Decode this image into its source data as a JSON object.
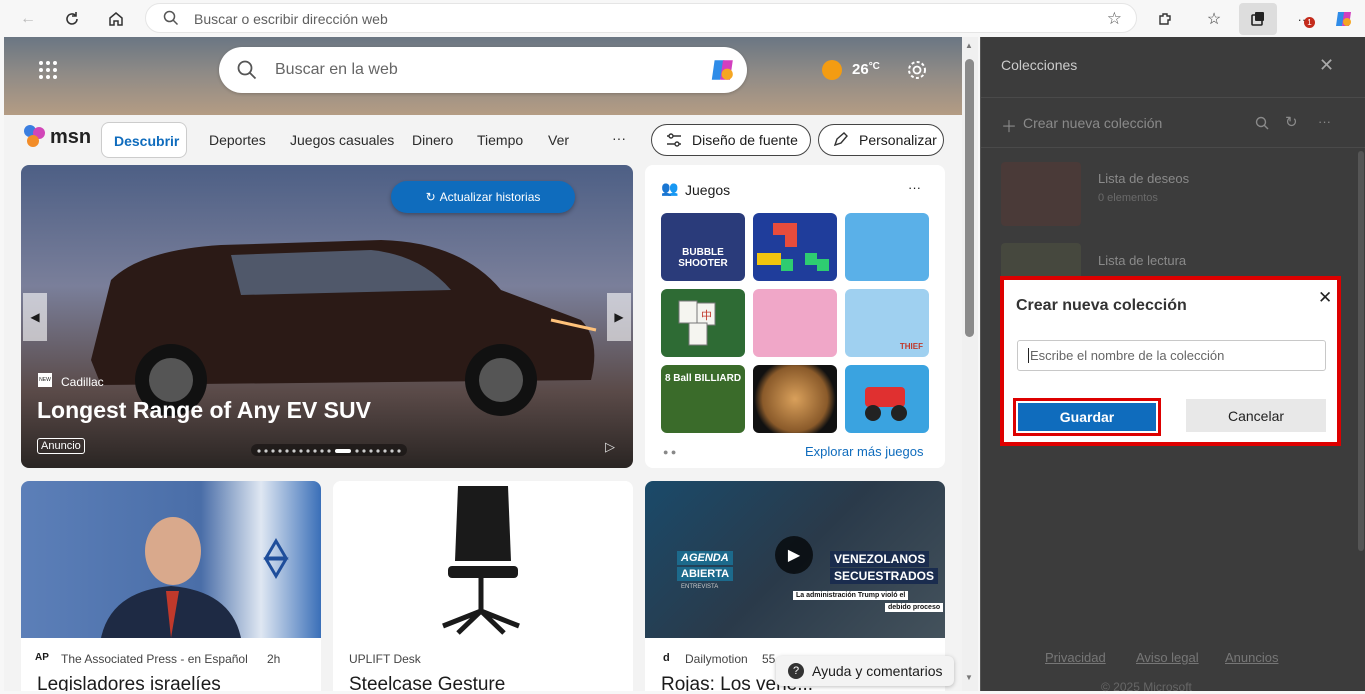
{
  "browser": {
    "address_placeholder": "Buscar o escribir dirección web",
    "notification_badge": "1"
  },
  "msn": {
    "search_placeholder": "Buscar en la web",
    "weather_temp": "26",
    "weather_unit": "°C",
    "logo_text": "msn",
    "nav": [
      "Descubrir",
      "Deportes",
      "Juegos casuales",
      "Dinero",
      "Tiempo",
      "Ver",
      "···"
    ],
    "font_button": "Diseño de fuente",
    "personalize_button": "Personalizar",
    "hero": {
      "refresh_button": "Actualizar historias",
      "brand": "Cadillac",
      "brand_badge": "NEW",
      "headline": "Longest Range of Any EV SUV",
      "ad_label": "Anuncio"
    },
    "games": {
      "title": "Juegos",
      "more": "···",
      "explore": "Explorar más juegos",
      "tiles": [
        {
          "label": "BUBBLE SHOOTER",
          "color": "#2a3b7a"
        },
        {
          "label": "",
          "color": "#1f3d9b"
        },
        {
          "label": "",
          "color": "#5ab0e8"
        },
        {
          "label": "",
          "color": "#2e6b34"
        },
        {
          "label": "",
          "color": "#f0a7c8"
        },
        {
          "label": "THIEF",
          "color": "#9fd0f0"
        },
        {
          "label": "8 Ball BILLIARD",
          "color": "#3a6b2a"
        },
        {
          "label": "",
          "color": "#b5782e"
        },
        {
          "label": "",
          "color": "#3aa3e0"
        }
      ]
    },
    "news": [
      {
        "source": "The Associated Press - en Español",
        "time": "2h",
        "title": "Legisladores israelíes",
        "source_logo": "AP"
      },
      {
        "source": "UPLIFT Desk",
        "time": "",
        "title": "Steelcase Gesture",
        "source_logo": ""
      },
      {
        "source": "Dailymotion",
        "time": "55",
        "title": "Rojas: Los vene...",
        "source_logo": "d"
      }
    ],
    "video_overlay": {
      "line1": "AGENDA",
      "line2": "ABIERTA",
      "line3": "ENTREVISTA",
      "headline1": "VENEZOLANOS",
      "headline2": "SECUESTRADOS",
      "sub1": "La administración Trump violó el",
      "sub2": "debido proceso"
    },
    "help_button": "Ayuda y comentarios"
  },
  "collections": {
    "title": "Colecciones",
    "create_new": "Crear nueva colección",
    "items": [
      {
        "name": "Lista de deseos",
        "count": "0 elementos"
      },
      {
        "name": "Lista de lectura",
        "count": ""
      }
    ],
    "footer": [
      "Privacidad",
      "Aviso legal",
      "Anuncios"
    ],
    "copyright": "© 2025 Microsoft"
  },
  "dialog": {
    "title": "Crear nueva colección",
    "input_placeholder": "Escribe el nombre de la colección",
    "save": "Guardar",
    "cancel": "Cancelar"
  },
  "colors": {
    "accent": "#0f6cbd",
    "highlight_border": "#dd0000",
    "panel_bg": "#3c3c3c"
  }
}
